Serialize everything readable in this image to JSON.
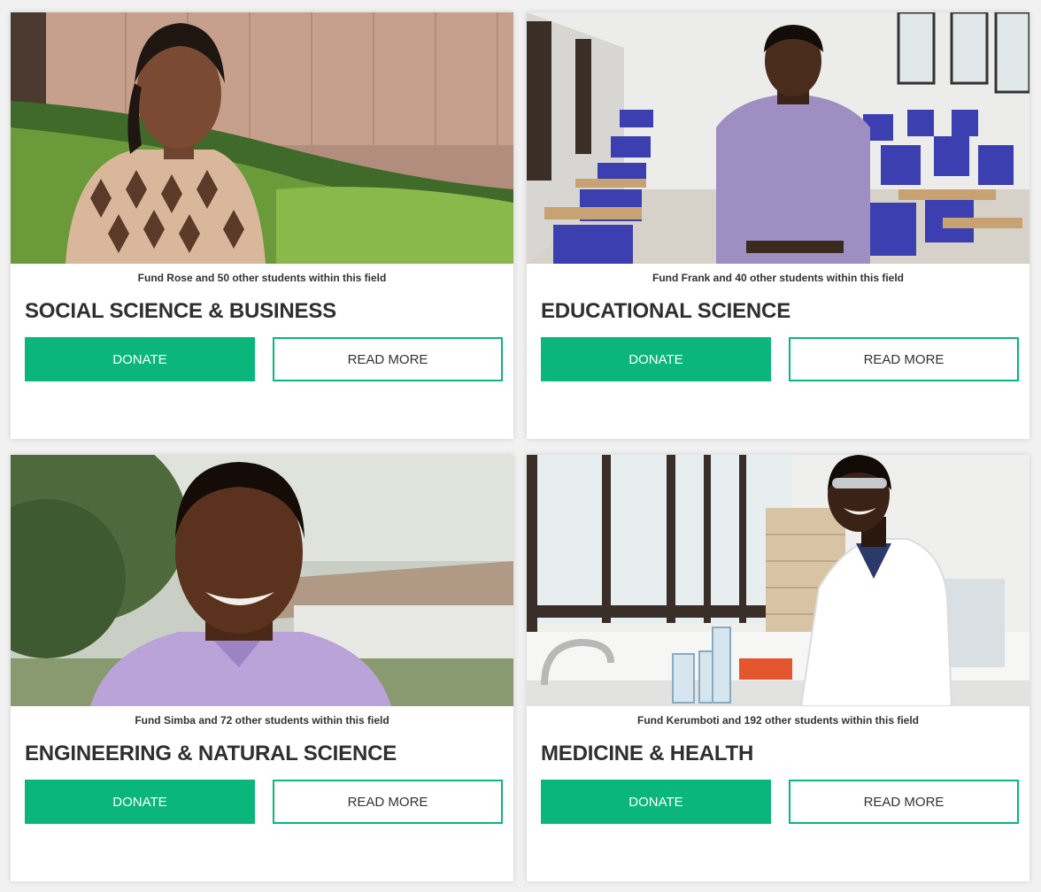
{
  "colors": {
    "accent": "#0ab67c",
    "title_text": "#2f2f2f",
    "caption_text": "#333333",
    "card_bg": "#ffffff",
    "page_bg": "#f1f1f1"
  },
  "cards": [
    {
      "caption": "Fund Rose and 50 other students within this field",
      "title": "SOCIAL SCIENCE & BUSINESS",
      "donate_label": "DONATE",
      "read_more_label": "READ MORE"
    },
    {
      "caption": "Fund Frank and 40 other students within this field",
      "title": "EDUCATIONAL SCIENCE",
      "donate_label": "DONATE",
      "read_more_label": "READ MORE"
    },
    {
      "caption": "Fund Simba and 72 other students within this field",
      "title": "ENGINEERING & NATURAL SCIENCE",
      "donate_label": "DONATE",
      "read_more_label": "READ MORE"
    },
    {
      "caption": "Fund Kerumboti and 192 other students within this field",
      "title": "MEDICINE & HEALTH",
      "donate_label": "DONATE",
      "read_more_label": "READ MORE"
    }
  ]
}
